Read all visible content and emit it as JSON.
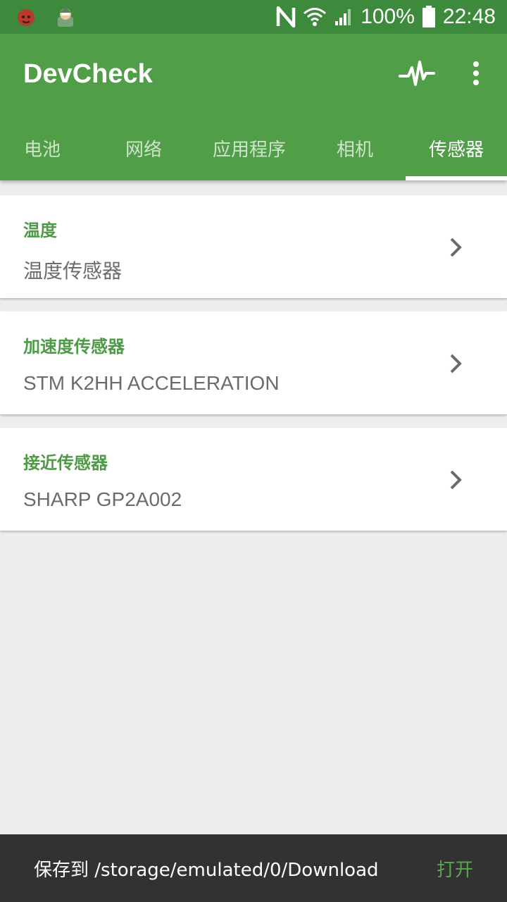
{
  "status_bar": {
    "battery_percent": "100%",
    "time": "22:48"
  },
  "app": {
    "title": "DevCheck",
    "accent_color": "#509e47"
  },
  "tabs": [
    {
      "label": "电池"
    },
    {
      "label": "网络"
    },
    {
      "label": "应用程序"
    },
    {
      "label": "相机"
    },
    {
      "label": "传感器",
      "active": true
    }
  ],
  "sensors": [
    {
      "title": "温度",
      "subtitle": "温度传感器"
    },
    {
      "title": "加速度传感器",
      "subtitle": "STM K2HH ACCELERATION"
    },
    {
      "title": "接近传感器",
      "subtitle": "SHARP GP2A002"
    }
  ],
  "snackbar": {
    "message": "保存到 /storage/emulated/0/Download",
    "action": "打开"
  },
  "icons": {
    "notification_1": "app-notification-icon",
    "notification_2": "app-notification-icon",
    "nfc": "nfc-icon",
    "wifi": "wifi-icon",
    "signal": "signal-icon",
    "battery": "battery-icon",
    "monitor": "pulse-icon",
    "menu": "more-vert-icon",
    "row_arrow": "chevron-right-icon"
  }
}
